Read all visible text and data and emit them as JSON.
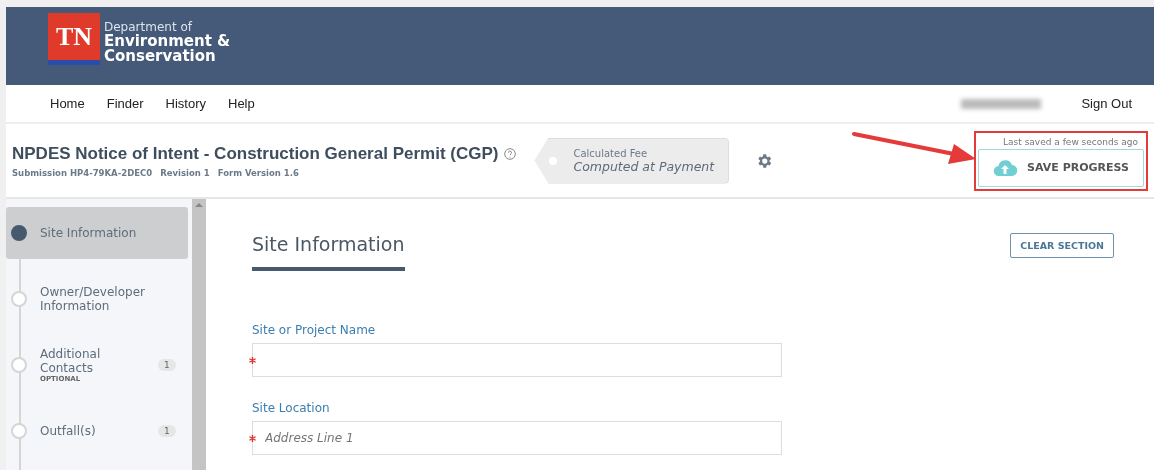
{
  "header": {
    "logo_mark": "TN",
    "org_line1": "Department of",
    "org_line2": "Environment &",
    "org_line3": "Conservation"
  },
  "nav": {
    "items": [
      "Home",
      "Finder",
      "History",
      "Help"
    ],
    "sign_out": "Sign Out"
  },
  "form_header": {
    "title": "NPDES Notice of Intent - Construction General Permit (CGP)",
    "submission": "Submission HP4-79KA-2DEC0",
    "revision": "Revision 1",
    "version": "Form Version 1.6",
    "fee_label": "Calculated Fee",
    "fee_value": "Computed at Payment",
    "last_saved": "Last saved a few seconds ago",
    "save_button": "SAVE PROGRESS"
  },
  "sidebar": {
    "items": [
      {
        "label": "Site Information",
        "selected": true
      },
      {
        "label": "Owner/Developer Information",
        "selected": false
      },
      {
        "label": "Additional Contacts",
        "selected": false,
        "count": "1",
        "note": "OPTIONAL"
      },
      {
        "label": "Outfall(s)",
        "selected": false,
        "count": "1"
      }
    ]
  },
  "section": {
    "title": "Site Information",
    "clear_button": "CLEAR SECTION",
    "fields": [
      {
        "label": "Site or Project Name",
        "required": true
      },
      {
        "label": "Site Location",
        "required": true,
        "placeholder": "Address Line 1"
      }
    ]
  }
}
